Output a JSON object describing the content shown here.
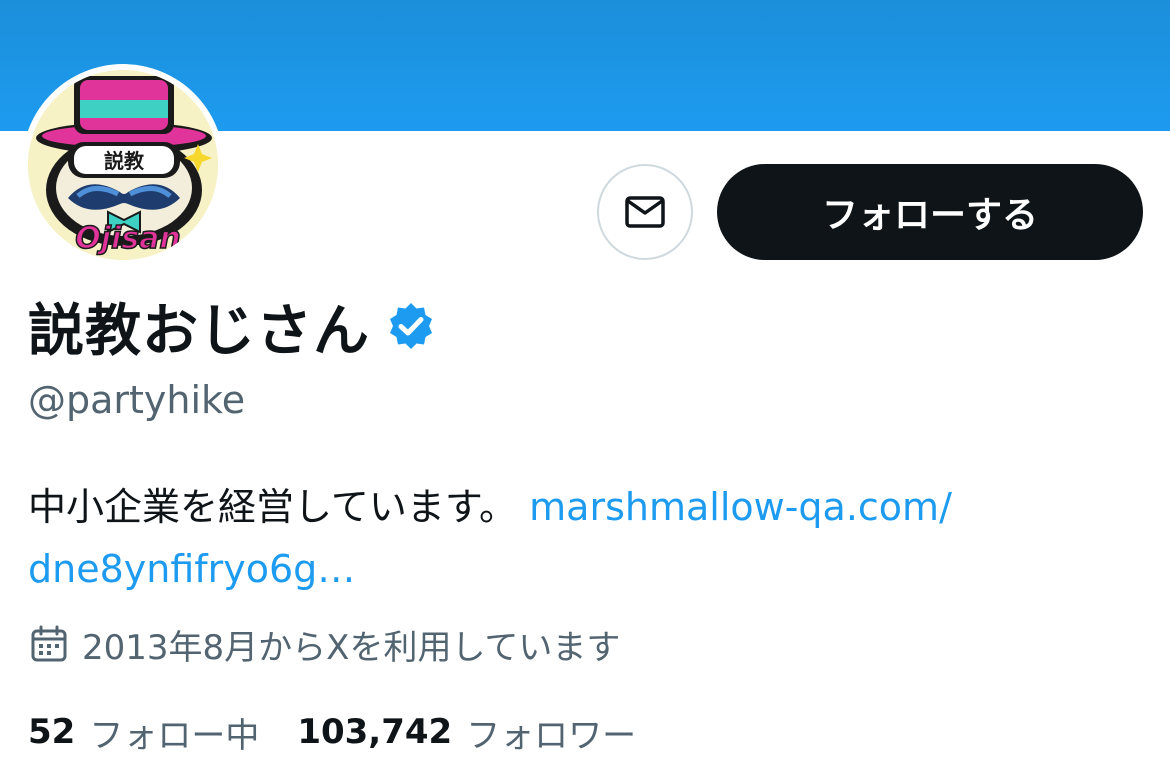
{
  "profile": {
    "display_name": "説教おじさん",
    "handle": "@partyhike",
    "verified_icon": "verified-badge-icon",
    "avatar_text": {
      "top": "説教",
      "bottom": "Ojisan"
    }
  },
  "actions": {
    "message_icon": "mail-icon",
    "follow_label": "フォローする"
  },
  "bio": {
    "text": "中小企業を経営しています。",
    "link_label": "marshmallow-qa.com/ dne8ynfifryo6g…"
  },
  "joined": {
    "icon": "calendar-icon",
    "text": "2013年8月からXを利用しています"
  },
  "stats": {
    "following_count": "52",
    "following_label": "フォロー中",
    "followers_count": "103,742",
    "followers_label": "フォロワー"
  },
  "colors": {
    "banner": "#1d9bf0",
    "accent": "#1d9bf0",
    "button_dark": "#0f1419",
    "secondary_text": "#536471"
  }
}
